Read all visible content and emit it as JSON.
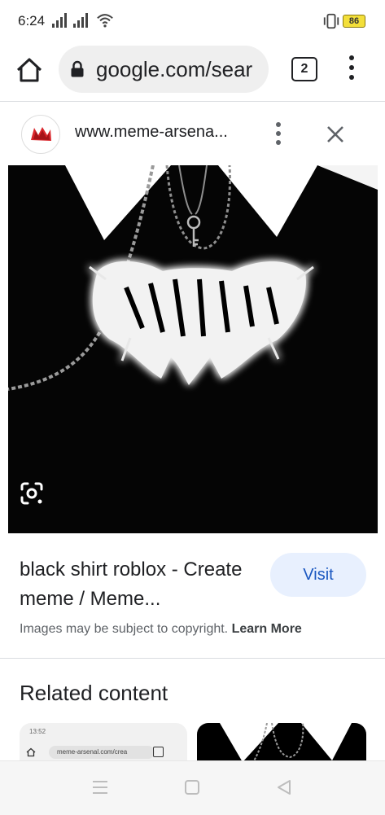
{
  "status_bar": {
    "time": "6:24",
    "battery": "86",
    "icons": [
      "signal-icon",
      "signal-icon",
      "wifi-icon",
      "vibrate-icon",
      "battery-icon"
    ]
  },
  "toolbar": {
    "url": "google.com/sear",
    "tab_count": "2",
    "icons": [
      "home-icon",
      "lock-icon",
      "more-vert-icon"
    ]
  },
  "source": {
    "site": "www.meme-arsena...",
    "icons": [
      "favicon",
      "more-vert-icon",
      "close-icon"
    ]
  },
  "image": {
    "icons": [
      "lens-icon"
    ]
  },
  "result": {
    "title": "black shirt roblox - Create meme / Meme...",
    "visit_label": "Visit",
    "copyright_text": "Images may be subject to copyright.",
    "learn_more": "Learn More"
  },
  "related": {
    "heading": "Related content",
    "thumb1_url": "meme-arsenal.com/crea",
    "thumb1_time": "13:52"
  },
  "nav_bar": {
    "icons": [
      "recents-icon",
      "home-nav-icon",
      "back-icon"
    ]
  },
  "colors": {
    "accent": "#1a57c0",
    "visit_bg": "#e8f0fe",
    "battery": "#f3df3a"
  }
}
